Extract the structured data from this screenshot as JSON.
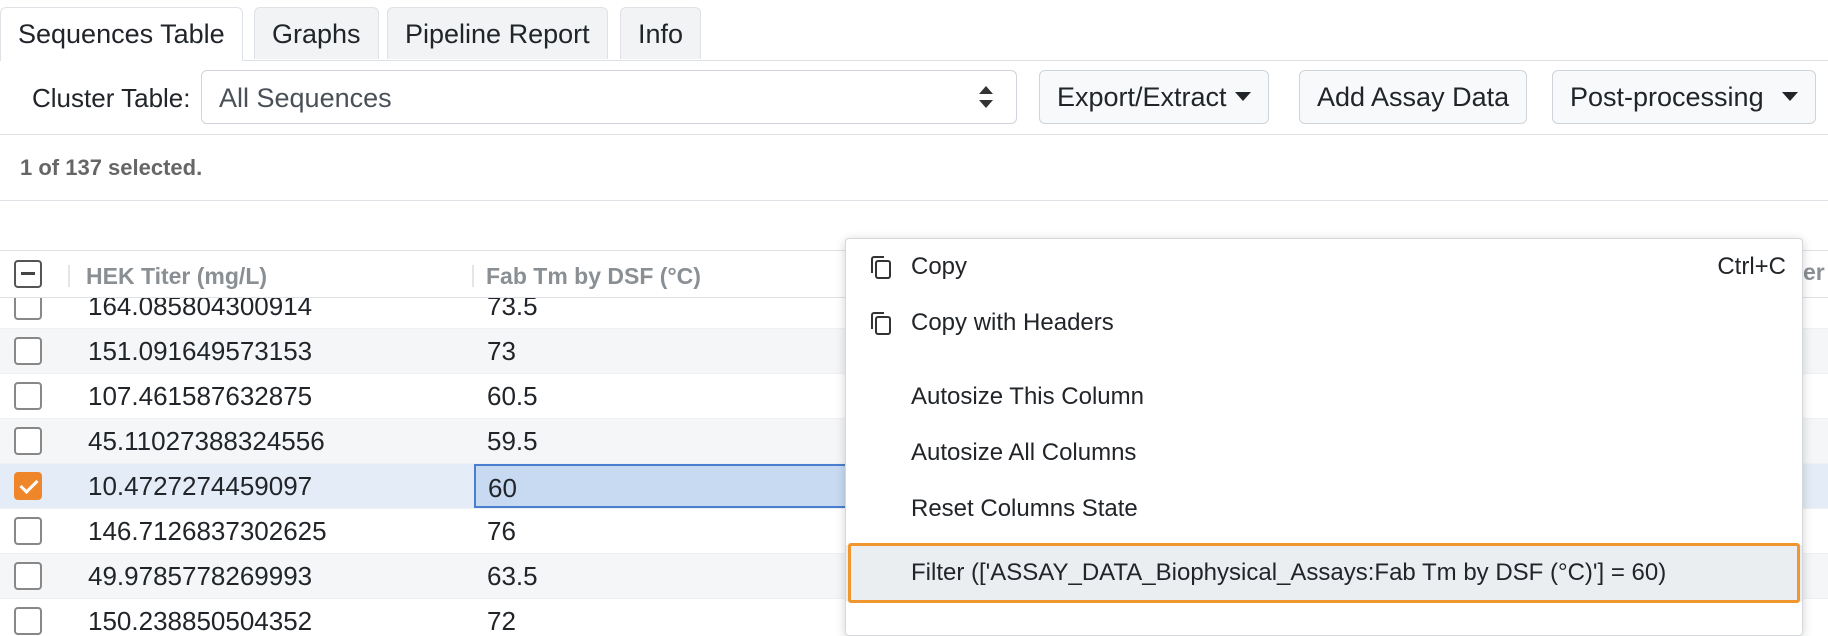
{
  "tabs": [
    {
      "label": "Sequences Table",
      "active": true
    },
    {
      "label": "Graphs",
      "active": false
    },
    {
      "label": "Pipeline Report",
      "active": false
    },
    {
      "label": "Info",
      "active": false
    }
  ],
  "toolbar": {
    "cluster_label": "Cluster Table:",
    "cluster_value": "All Sequences",
    "export_label": "Export/Extract",
    "assay_label": "Add Assay Data",
    "postproc_label": "Post-processing"
  },
  "selection": {
    "count_text": "1 of 137 selected."
  },
  "grid": {
    "columns": [
      "HEK Titer (mg/L)",
      "Fab Tm by DSF (°C)"
    ],
    "next_column_fragment": "er",
    "rows": [
      {
        "titer": "164.085804300914",
        "tm": "73.5",
        "checked": false
      },
      {
        "titer": "151.091649573153",
        "tm": "73",
        "checked": false
      },
      {
        "titer": "107.461587632875",
        "tm": "60.5",
        "checked": false
      },
      {
        "titer": "45.11027388324556",
        "tm": "59.5",
        "checked": false
      },
      {
        "titer": "10.4727274459097",
        "tm": "60",
        "checked": true
      },
      {
        "titer": "146.7126837302625",
        "tm": "76",
        "checked": false
      },
      {
        "titer": "49.9785778269993",
        "tm": "63.5",
        "checked": false
      },
      {
        "titer": "150.238850504352",
        "tm": "72",
        "checked": false
      }
    ]
  },
  "context_menu": {
    "items": [
      {
        "label": "Copy",
        "shortcut": "Ctrl+C",
        "icon": "copy-icon"
      },
      {
        "label": "Copy with Headers",
        "icon": "copy-icon"
      },
      {
        "label": "Autosize This Column"
      },
      {
        "label": "Autosize All Columns"
      },
      {
        "label": "Reset Columns State"
      },
      {
        "label": "Filter (['ASSAY_DATA_Biophysical_Assays:Fab Tm by DSF (°C)'] = 60)",
        "highlighted": true
      }
    ]
  },
  "colors": {
    "accent_checkbox": "#f0862a",
    "highlight_outline": "#f0962e",
    "selected_row": "#e3ecf7",
    "focused_cell": "#c8daf1"
  }
}
